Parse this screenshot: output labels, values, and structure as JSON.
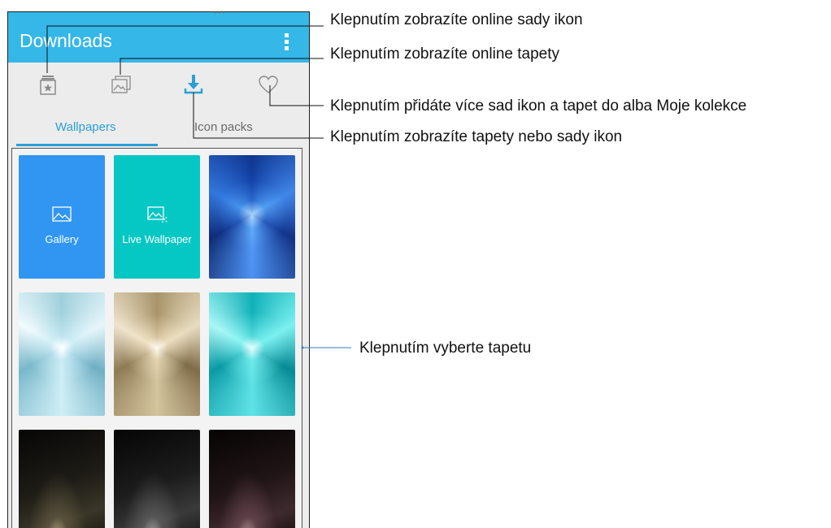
{
  "app": {
    "title": "Downloads"
  },
  "toolbar": {
    "icons": [
      "icon-packs-icon",
      "online-wallpapers-icon",
      "download-icon",
      "favorite-heart-icon"
    ],
    "accent": "#2a9fd8"
  },
  "tabs": {
    "wallpapers": "Wallpapers",
    "icon_packs": "Icon packs",
    "active": "Wallpapers"
  },
  "tiles": {
    "gallery": "Gallery",
    "live_wallpaper": "Live Wallpaper"
  },
  "callouts": {
    "icon_packs": "Klepnutím zobrazíte online sady ikon",
    "wallpapers": "Klepnutím zobrazíte online tapety",
    "favorites": "Klepnutím přidáte více sad ikon a tapet do alba Moje kolekce",
    "downloads": "Klepnutím zobrazíte tapety nebo sady ikon",
    "select": "Klepnutím vyberte tapetu"
  },
  "colors": {
    "appbar": "#35b7e8",
    "gallery_tile": "#3196f2",
    "live_tile": "#05c7c4"
  }
}
